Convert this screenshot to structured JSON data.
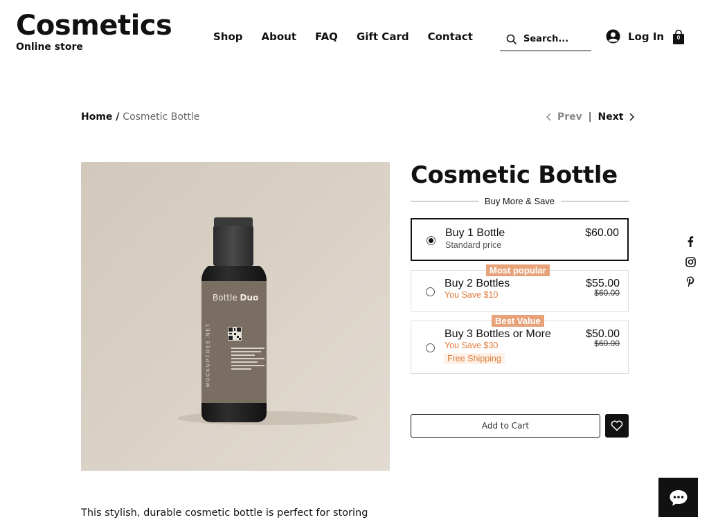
{
  "brand": {
    "title": "Cosmetics",
    "subtitle": "Online store"
  },
  "nav": {
    "items": [
      "Shop",
      "About",
      "FAQ",
      "Gift Card",
      "Contact"
    ]
  },
  "search": {
    "placeholder": "Search..."
  },
  "login": {
    "label": "Log In"
  },
  "cart": {
    "count": "0"
  },
  "breadcrumb": {
    "home": "Home",
    "separator": " / ",
    "current": "Cosmetic Bottle"
  },
  "pager": {
    "prev": "Prev",
    "separator": "|",
    "next": "Next"
  },
  "product": {
    "title": "Cosmetic Bottle",
    "bundle_heading": "Buy More & Save",
    "image_text": {
      "brand": "Bottle",
      "brand_bold": "Duo",
      "vertical": "MOCKUPFREE.NET"
    },
    "options": [
      {
        "name": "Buy 1 Bottle",
        "sub": "Standard price",
        "price": "$60.00",
        "selected": true
      },
      {
        "tag": "Most popular",
        "name": "Buy 2 Bottles",
        "sub": "You Save $10",
        "price": "$55.00",
        "original": "$60.00"
      },
      {
        "tag": "Best Value",
        "name": "Buy 3 Bottles or More",
        "sub": "You Save $30",
        "extra": "Free Shipping",
        "price": "$50.00",
        "original": "$60.00"
      }
    ],
    "add_to_cart": "Add to Cart",
    "description": "This stylish, durable cosmetic bottle is perfect for storing"
  },
  "colors": {
    "accent": "#e07b3b",
    "tag_bg": "#e8a27a",
    "dark": "#111111"
  },
  "icons": [
    "search-icon",
    "user-avatar-icon",
    "shopping-bag-icon",
    "chevron-left-icon",
    "chevron-right-icon",
    "heart-icon",
    "facebook-icon",
    "instagram-icon",
    "pinterest-icon",
    "chat-icon"
  ]
}
